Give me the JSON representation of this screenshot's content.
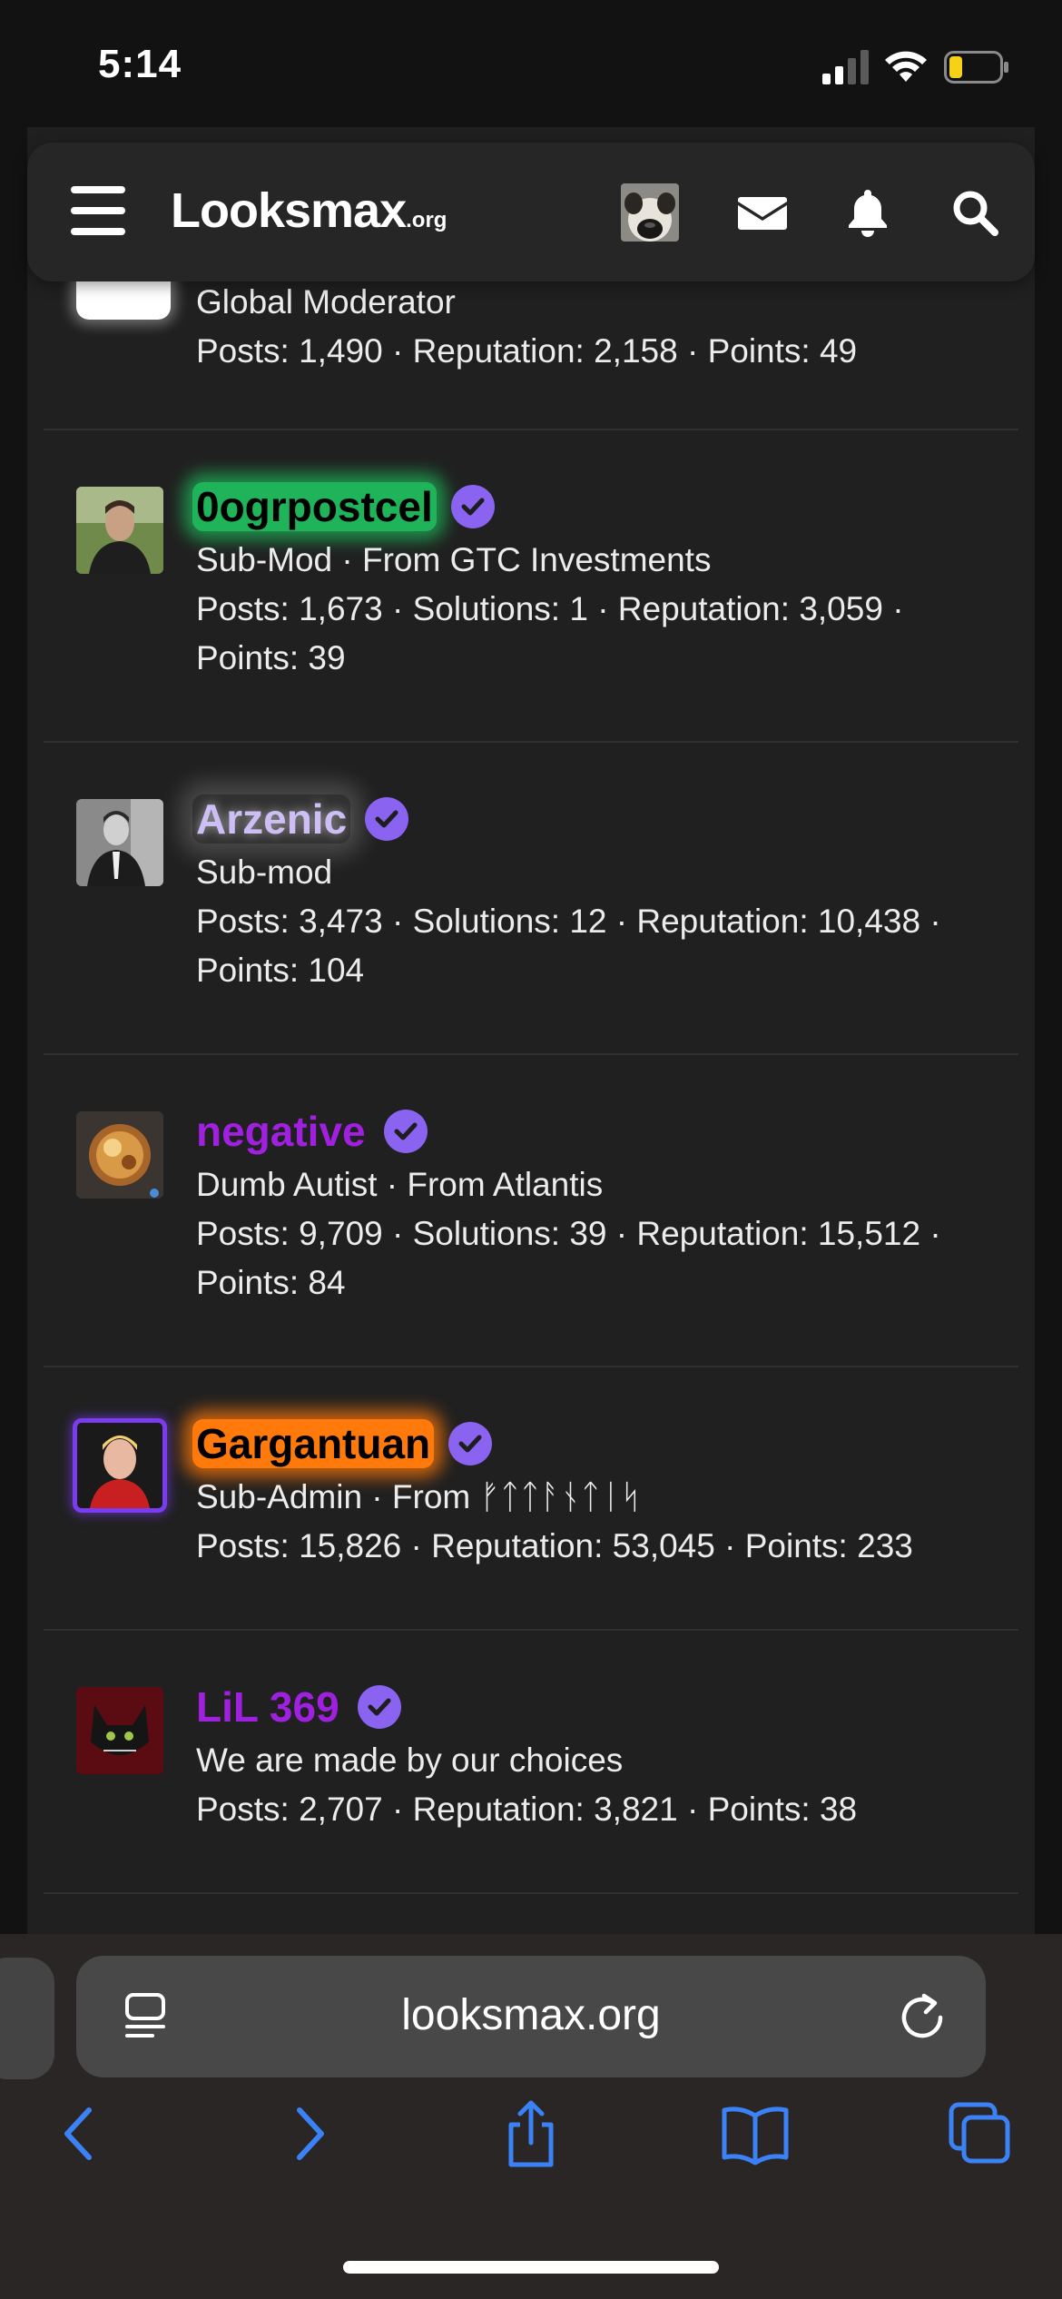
{
  "status_bar": {
    "time": "5:14"
  },
  "header": {
    "logo_main": "Looksmax",
    "logo_tld": ".org"
  },
  "members": [
    {
      "name": "",
      "title": "Global Moderator",
      "stats": "Posts: 1,490 · Reputation: 2,158 · Points: 49"
    },
    {
      "name": "0ogrpostcel",
      "title": "Sub-Mod · From GTC Investments",
      "stats1": "Posts: 1,673 · Solutions: 1 · Reputation: 3,059 ·",
      "stats2": "Points: 39"
    },
    {
      "name": "Arzenic",
      "title": "Sub-mod",
      "stats1": "Posts: 3,473 · Solutions: 12 · Reputation: 10,438 ·",
      "stats2": "Points: 104"
    },
    {
      "name": "negative",
      "title": "Dumb Autist · From Atlantis",
      "stats1": "Posts: 9,709 · Solutions: 39 · Reputation: 15,512 ·",
      "stats2": "Points: 84"
    },
    {
      "name": "Gargantuan",
      "title": "Sub-Admin · From ᚠᛏᛏᚨᚾᛏᛁᛋ",
      "stats": "Posts: 15,826 · Reputation: 53,045 · Points: 233"
    },
    {
      "name": "LiL 369",
      "title": "We are made by our choices",
      "stats": "Posts: 2,707 · Reputation: 3,821 · Points: 38"
    }
  ],
  "safari": {
    "url": "looksmax.org"
  },
  "colors": {
    "background": "#202020",
    "verified_badge": "#8a63f0",
    "green_user": "#1fb45a",
    "orange_user": "#ff7a0a",
    "purple_user": "#a020e0",
    "safari_blue": "#3b82f6"
  },
  "icons": {
    "header": [
      "menu-icon",
      "mail-icon",
      "bell-icon",
      "search-icon"
    ],
    "safari": [
      "reader-icon",
      "reload-icon",
      "back-icon",
      "forward-icon",
      "share-icon",
      "bookmarks-icon",
      "tabs-icon"
    ]
  }
}
